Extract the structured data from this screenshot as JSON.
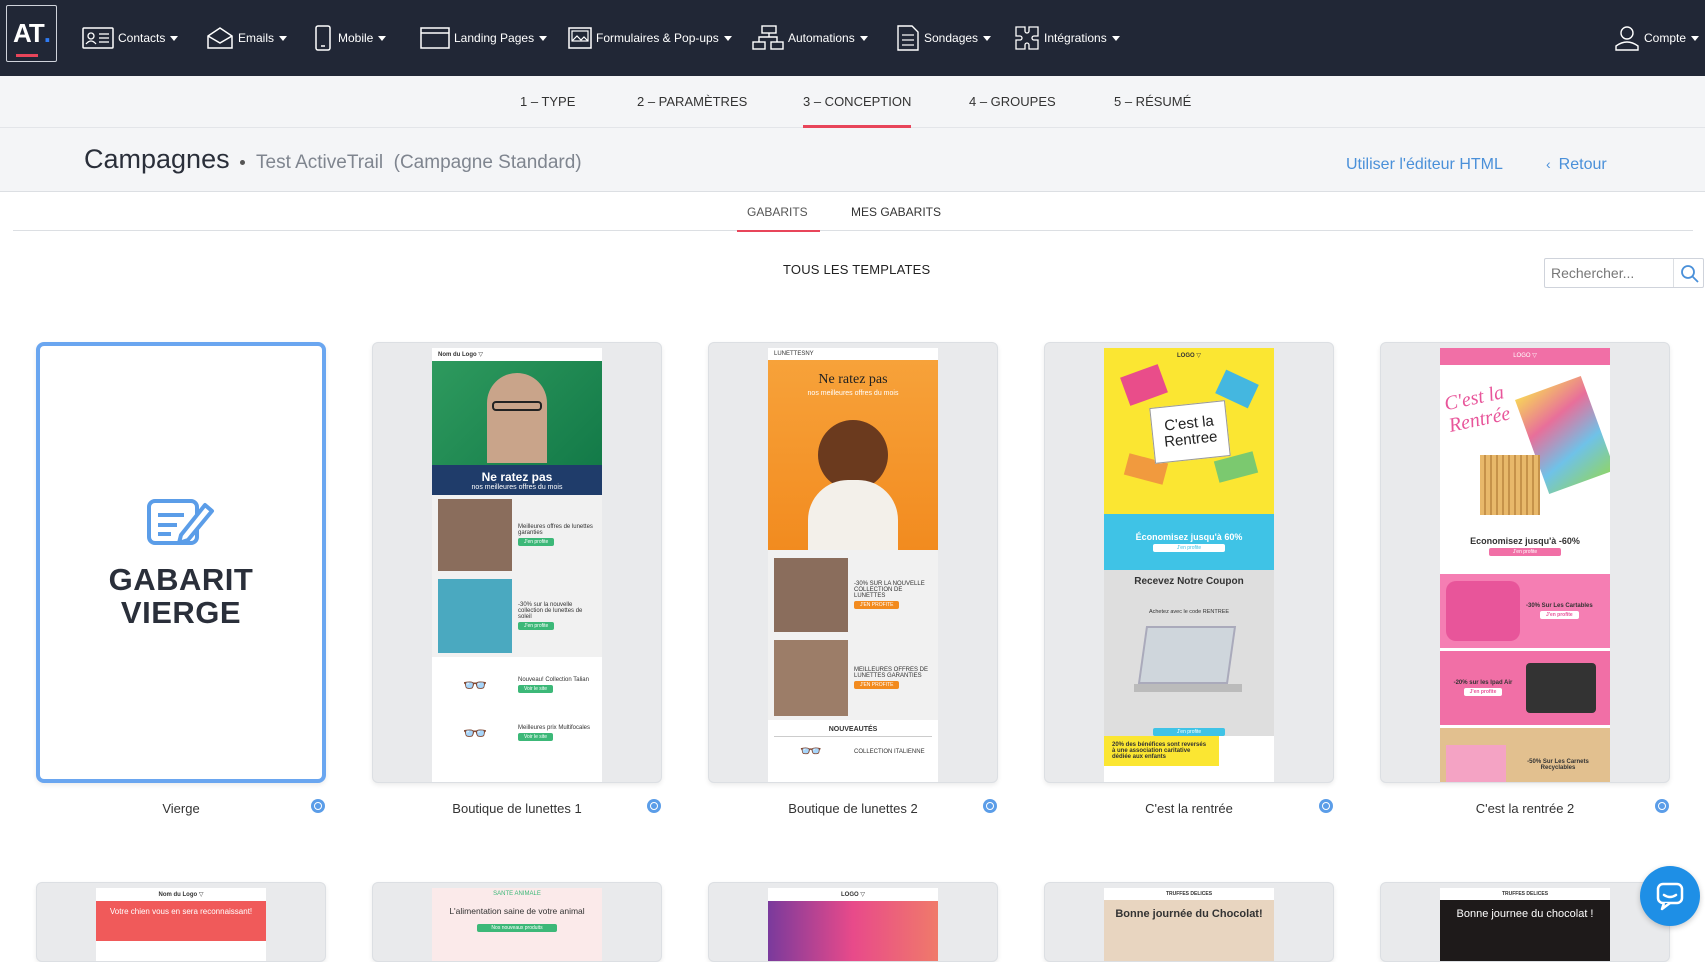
{
  "nav": {
    "logo": "AT",
    "items": [
      {
        "label": "Contacts"
      },
      {
        "label": "Emails"
      },
      {
        "label": "Mobile"
      },
      {
        "label": "Landing Pages"
      },
      {
        "label": "Formulaires & Pop-ups"
      },
      {
        "label": "Automations"
      },
      {
        "label": "Sondages"
      },
      {
        "label": "Intégrations"
      }
    ],
    "account": "Compte"
  },
  "steps": [
    {
      "label": "1 – TYPE"
    },
    {
      "label": "2 – PARAMÈTRES"
    },
    {
      "label": "3 – CONCEPTION",
      "active": true
    },
    {
      "label": "4 – GROUPES"
    },
    {
      "label": "5 – RÉSUMÉ"
    }
  ],
  "header": {
    "title": "Campagnes",
    "campaign_name": "Test ActiveTrail",
    "campaign_type": "(Campagne Standard)",
    "html_editor_link": "Utiliser l'éditeur HTML",
    "back_link": "Retour"
  },
  "tabs": [
    {
      "label": "GABARITS",
      "active": true
    },
    {
      "label": "MES GABARITS"
    }
  ],
  "filter_label": "TOUS LES TEMPLATES",
  "search": {
    "placeholder": "Rechercher..."
  },
  "templates": [
    {
      "label": "Vierge",
      "blank_title_1": "GABARIT",
      "blank_title_2": "VIERGE"
    },
    {
      "label": "Boutique de lunettes 1",
      "preview": {
        "logo": "Nom du Logo ▽",
        "headline": "Ne ratez pas",
        "sub": "nos meilleures offres du mois",
        "row1": "Meilleures offres de lunettes garanties",
        "row2": "-30% sur la nouvelle collection de lunettes de soleil",
        "row3": "Nouveau! Collection Talian",
        "row4": "Meilleures prix Multifocales",
        "btn": "J'en profite",
        "btn2": "Voir le site"
      }
    },
    {
      "label": "Boutique de lunettes 2",
      "preview": {
        "logo": "LUNETTESNY",
        "headline": "Ne ratez pas",
        "sub": "nos meilleures offres du mois",
        "row1": "-30% SUR LA NOUVELLE COLLECTION DE LUNETTES",
        "row2": "MEILLEURES OFFRES DE LUNETTES GARANTIES",
        "btn": "J'EN PROFITE",
        "section": "NOUVEAUTÉS",
        "row3": "COLLECTION ITALIENNE"
      }
    },
    {
      "label": "C'est la rentrée",
      "preview": {
        "logo": "LOGO ▽",
        "sign": "C'est la Rentree",
        "offer": "Économisez jusqu'à 60%",
        "coupon": "Recevez Notre Coupon",
        "code": "Achetez avec le code RENTREE",
        "btn": "J'en profite",
        "footer": "20% des bénéfices sont reversés à une association caritative dédiée aux enfants"
      }
    },
    {
      "label": "C'est la rentrée 2",
      "preview": {
        "logo": "LOGO ▽",
        "script": "C'est la Rentrée",
        "offer": "Economisez jusqu'à -60%",
        "row1": "-30% Sur Les Cartables",
        "row2": "-20% sur les Ipad Air",
        "row3": "-50% Sur Les Carnets Recyclables",
        "btn": "J'en profite"
      }
    }
  ],
  "second_row": [
    {
      "logo": "Nom du Logo ▽",
      "text": "Votre chien vous en sera reconnaissant!"
    },
    {
      "logo": "SANTE ANIMALE",
      "text": "L'alimentation saine de votre animal",
      "btn": "Nos nouveaux produits"
    },
    {
      "logo": "LOGO ▽"
    },
    {
      "logo": "TRUFFES DELICES",
      "text": "Bonne journée du Chocolat!"
    },
    {
      "logo": "TRUFFES DELICES",
      "text": "Bonne journee du chocolat !"
    }
  ],
  "colors": {
    "nav_bg": "#212736",
    "accent_red": "#e8455a",
    "link_blue": "#4a90d9",
    "blank_border": "#6aa6f0",
    "chat_blue": "#1e8fe6"
  }
}
